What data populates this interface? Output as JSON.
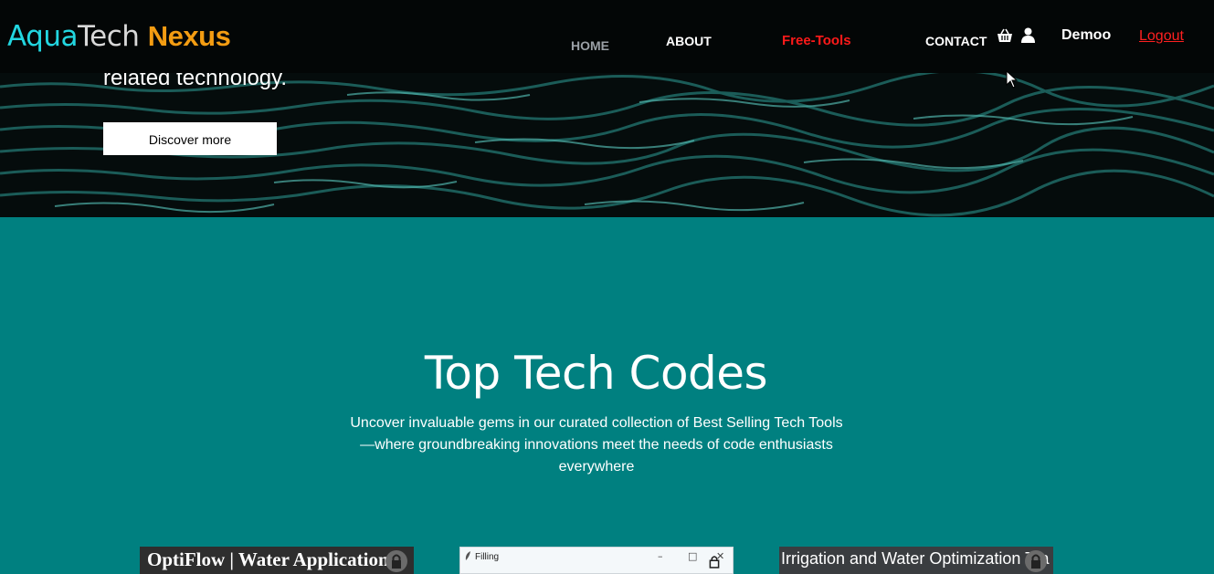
{
  "nav": {
    "brand": {
      "part1": "Aqua",
      "part2": "Tech",
      "part3": "Nexus"
    },
    "links": {
      "home": "HOME",
      "about": "ABOUT",
      "free_tools": "Free-Tools",
      "contact": "CONTACT"
    },
    "icons": {
      "cart": "basket-icon",
      "user": "user-icon"
    },
    "username": "Demoo",
    "logout": "Logout"
  },
  "hero": {
    "text": "related technology.",
    "button": "Discover more"
  },
  "section": {
    "title": "Top Tech Codes",
    "description": "Uncover invaluable gems in our curated collection of Best Selling Tech Tools—where groundbreaking innovations meet the needs of code enthusiasts everywhere"
  },
  "cards": [
    {
      "title": "OptiFlow | Water Applications"
    },
    {
      "title": "Filling"
    },
    {
      "title": "Irrigation and Water Optimization Tra"
    }
  ],
  "colors": {
    "background": "#008080",
    "brand_aqua": "#22d6e0",
    "brand_nexus": "#f39c12",
    "free_tools": "#ff1a1a",
    "logout": "#ff2020"
  }
}
